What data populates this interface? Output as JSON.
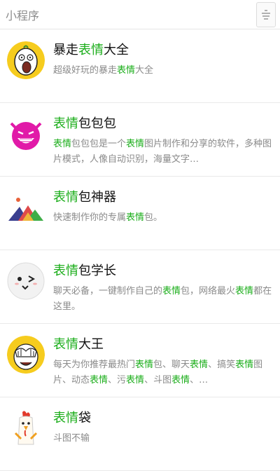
{
  "header": {
    "title": "小程序",
    "filter_icon": "filter-lines-icon"
  },
  "accent": "#1aad19",
  "items": [
    {
      "name": [
        [
          "暴走",
          ""
        ],
        [
          "表情",
          "hl"
        ],
        [
          "大全",
          ""
        ]
      ],
      "desc": [
        [
          "超级好玩的暴走",
          ""
        ],
        [
          "表情",
          "hl"
        ],
        [
          "大全",
          ""
        ]
      ],
      "avatar": "rage-face-icon"
    },
    {
      "name": [
        [
          "表情",
          "hl"
        ],
        [
          "包包包",
          ""
        ]
      ],
      "desc": [
        [
          "表情",
          "hl"
        ],
        [
          "包包包是一个",
          ""
        ],
        [
          "表情",
          "hl"
        ],
        [
          "图片制作和分享的软件，多种图片模式，人像自动识别，海量文字…",
          ""
        ]
      ],
      "avatar": "pink-devil-icon"
    },
    {
      "name": [
        [
          "表情",
          "hl"
        ],
        [
          "包神器",
          ""
        ]
      ],
      "desc": [
        [
          "快速制作你的专属",
          ""
        ],
        [
          "表情",
          "hl"
        ],
        [
          "包。",
          ""
        ]
      ],
      "avatar": "mountain-icon"
    },
    {
      "name": [
        [
          "表情",
          "hl"
        ],
        [
          "包学长",
          ""
        ]
      ],
      "desc": [
        [
          "聊天必备，一键制作自己的",
          ""
        ],
        [
          "表情",
          "hl"
        ],
        [
          "包，网络最火",
          ""
        ],
        [
          "表情",
          "hl"
        ],
        [
          "都在这里。",
          ""
        ]
      ],
      "avatar": "wink-face-icon"
    },
    {
      "name": [
        [
          "表情",
          "hl"
        ],
        [
          "大王",
          ""
        ]
      ],
      "desc": [
        [
          "每天为你推荐最热门",
          ""
        ],
        [
          "表情",
          "hl"
        ],
        [
          "包、聊天",
          ""
        ],
        [
          "表情",
          "hl"
        ],
        [
          "、搞笑",
          ""
        ],
        [
          "表情",
          "hl"
        ],
        [
          "图片、动态",
          ""
        ],
        [
          "表情",
          "hl"
        ],
        [
          "、污",
          ""
        ],
        [
          "表情",
          "hl"
        ],
        [
          "、斗图",
          ""
        ],
        [
          "表情",
          "hl"
        ],
        [
          "、…",
          ""
        ]
      ],
      "avatar": "facepalm-icon"
    },
    {
      "name": [
        [
          "表情",
          "hl"
        ],
        [
          "袋",
          ""
        ]
      ],
      "desc": [
        [
          "斗图不输",
          ""
        ]
      ],
      "avatar": "chicken-icon"
    }
  ]
}
